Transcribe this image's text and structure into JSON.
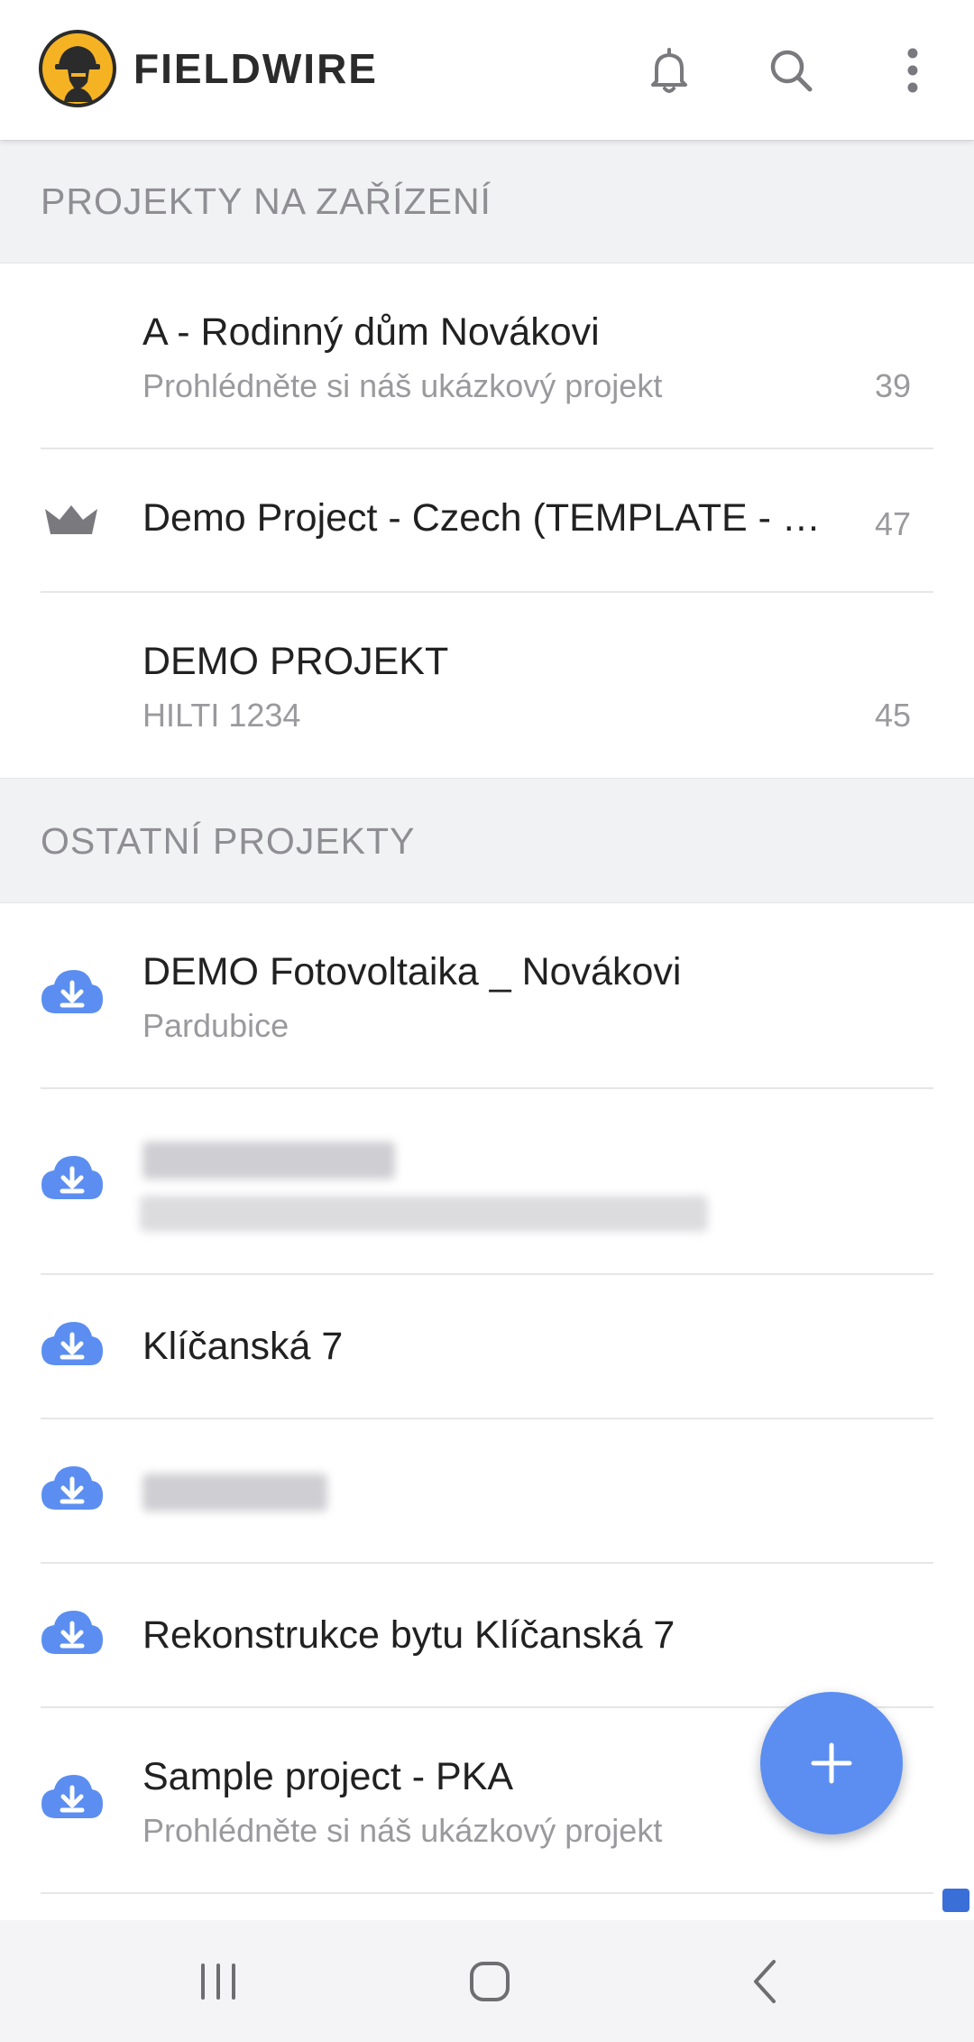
{
  "app": {
    "brand": "FIELDWIRE",
    "logo_icon": "fieldwire-worker-logo",
    "accent_color": "#5b8ef0",
    "logo_color": "#f5b324"
  },
  "toolbar": {
    "notifications_icon": "bell-icon",
    "search_icon": "search-icon",
    "more_icon": "more-vertical-icon"
  },
  "sections": {
    "on_device": "PROJEKTY NA ZAŘÍZENÍ",
    "other": "OSTATNÍ PROJEKTY"
  },
  "on_device_projects": [
    {
      "title": "A - Rodinný dům Novákovi",
      "subtitle": "Prohlédněte si náš ukázkový projekt",
      "count": "39"
    },
    {
      "title": "Demo Project - Czech (TEMPLATE - …",
      "count": "47",
      "icon": "crown-icon"
    },
    {
      "title": "DEMO PROJEKT",
      "subtitle": "HILTI 1234",
      "count": "45"
    }
  ],
  "other_projects": [
    {
      "title": "DEMO Fotovoltaika _ Novákovi",
      "subtitle": "Pardubice",
      "icon": "cloud-download-icon"
    },
    {
      "redacted": true,
      "icon": "cloud-download-icon"
    },
    {
      "title": "Klíčanská 7",
      "icon": "cloud-download-icon"
    },
    {
      "redacted": true,
      "icon": "cloud-download-icon"
    },
    {
      "title": "Rekonstrukce bytu Klíčanská 7",
      "icon": "cloud-download-icon"
    },
    {
      "title": "Sample project - PKA",
      "subtitle": "Prohlédněte si náš ukázkový projekt",
      "icon": "cloud-download-icon"
    }
  ],
  "fab": {
    "icon": "plus-icon"
  },
  "system_nav": {
    "recent": "recent-apps-icon",
    "home": "home-icon",
    "back": "back-icon"
  }
}
